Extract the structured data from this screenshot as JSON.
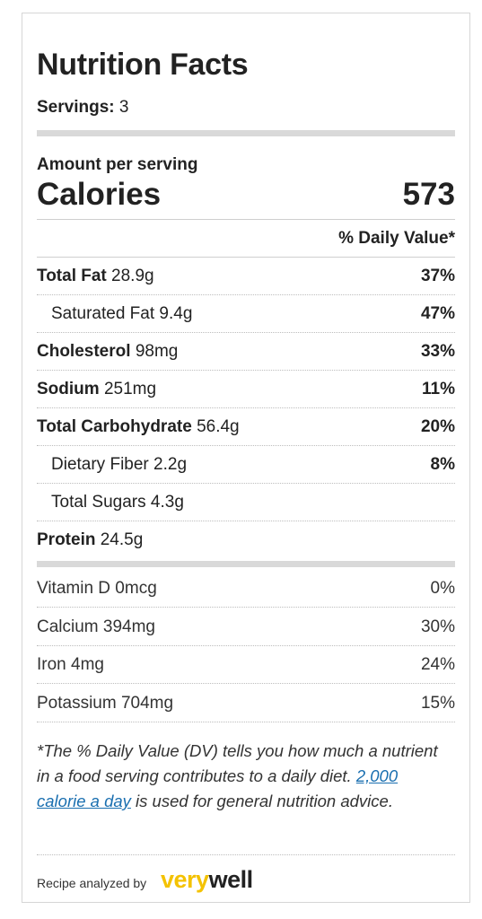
{
  "title": "Nutrition Facts",
  "servings": {
    "label": "Servings:",
    "value": "3"
  },
  "amount_label": "Amount per serving",
  "calories": {
    "label": "Calories",
    "value": "573"
  },
  "daily_value_header": "% Daily Value*",
  "nutrients": [
    {
      "name": "Total Fat",
      "amount": "28.9g",
      "dv": "37%"
    },
    {
      "name": "Saturated Fat",
      "amount": "9.4g",
      "dv": "47%"
    },
    {
      "name": "Cholesterol",
      "amount": "98mg",
      "dv": "33%"
    },
    {
      "name": "Sodium",
      "amount": "251mg",
      "dv": "11%"
    },
    {
      "name": "Total Carbohydrate",
      "amount": "56.4g",
      "dv": "20%"
    },
    {
      "name": "Dietary Fiber",
      "amount": "2.2g",
      "dv": "8%"
    },
    {
      "name": "Total Sugars",
      "amount": "4.3g",
      "dv": ""
    },
    {
      "name": "Protein",
      "amount": "24.5g",
      "dv": ""
    }
  ],
  "vitamins": [
    {
      "name": "Vitamin D",
      "amount": "0mcg",
      "dv": "0%"
    },
    {
      "name": "Calcium",
      "amount": "394mg",
      "dv": "30%"
    },
    {
      "name": "Iron",
      "amount": "4mg",
      "dv": "24%"
    },
    {
      "name": "Potassium",
      "amount": "704mg",
      "dv": "15%"
    }
  ],
  "footnote": {
    "before": "*The % Daily Value (DV) tells you how much a nutrient in a food serving contributes to a daily diet.",
    "link": "2,000 calorie a day",
    "after": "is used for general nutrition advice."
  },
  "credit": {
    "text": "Recipe analyzed by",
    "logo_part1": "very",
    "logo_part2": "well",
    "logo_colors": {
      "very": "#f4c200",
      "well": "#222222"
    }
  }
}
